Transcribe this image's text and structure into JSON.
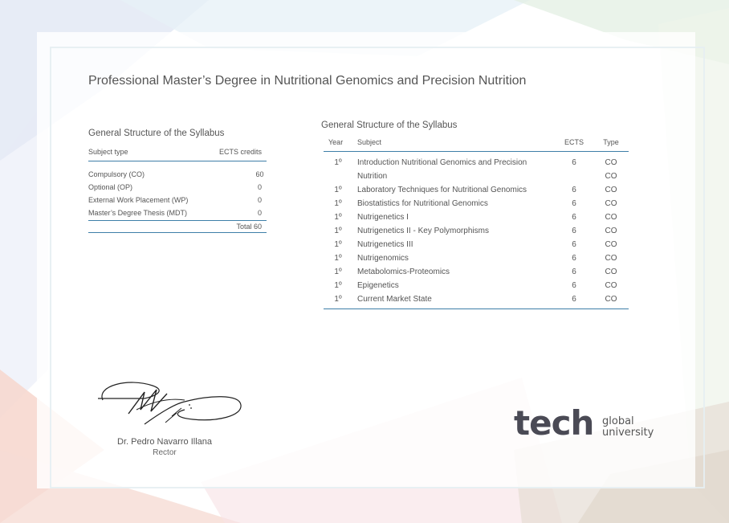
{
  "document": {
    "title": "Professional Master’s Degree in Nutritional Genomics and Precision Nutrition"
  },
  "summary": {
    "heading": "General Structure of the Syllabus",
    "col_subject_type": "Subject type",
    "col_ects": "ECTS credits",
    "rows": [
      {
        "type": "Compulsory (CO)",
        "credits": "60"
      },
      {
        "type": "Optional (OP)",
        "credits": "0"
      },
      {
        "type": "External Work Placement (WP)",
        "credits": "0"
      },
      {
        "type": "Master’s Degree Thesis (MDT)",
        "credits": "0"
      }
    ],
    "total": "Total 60"
  },
  "syllabus": {
    "heading": "General Structure of the Syllabus",
    "col_year": "Year",
    "col_subject": "Subject",
    "col_ects": "ECTS",
    "col_type": "Type",
    "rows": [
      {
        "year": "1º",
        "subject": "Introduction Nutritional Genomics and Precision",
        "ects": "6",
        "type": "CO"
      },
      {
        "year": "",
        "subject": "Nutrition",
        "ects": "",
        "type": "CO"
      },
      {
        "year": "1º",
        "subject": "Laboratory Techniques for Nutritional Genomics",
        "ects": "6",
        "type": "CO"
      },
      {
        "year": "1º",
        "subject": "Biostatistics for Nutritional Genomics",
        "ects": "6",
        "type": "CO"
      },
      {
        "year": "1º",
        "subject": "Nutrigenetics I",
        "ects": "6",
        "type": "CO"
      },
      {
        "year": "1º",
        "subject": "Nutrigenetics II - Key Polymorphisms",
        "ects": "6",
        "type": "CO"
      },
      {
        "year": "1º",
        "subject": "Nutrigenetics III",
        "ects": "6",
        "type": "CO"
      },
      {
        "year": "1º",
        "subject": "Nutrigenomics",
        "ects": "6",
        "type": "CO"
      },
      {
        "year": "1º",
        "subject": "Metabolomics-Proteomics",
        "ects": "6",
        "type": "CO"
      },
      {
        "year": "1º",
        "subject": "Epigenetics",
        "ects": "6",
        "type": "CO"
      },
      {
        "year": "1º",
        "subject": "Current Market State",
        "ects": "6",
        "type": "CO"
      }
    ]
  },
  "signer": {
    "name": "Dr. Pedro Navarro Illana",
    "role": "Rector"
  },
  "logo": {
    "word": "tech",
    "line1": "global",
    "line2": "university"
  },
  "colors": {
    "rule": "#3e7fa8",
    "text": "#555555"
  }
}
